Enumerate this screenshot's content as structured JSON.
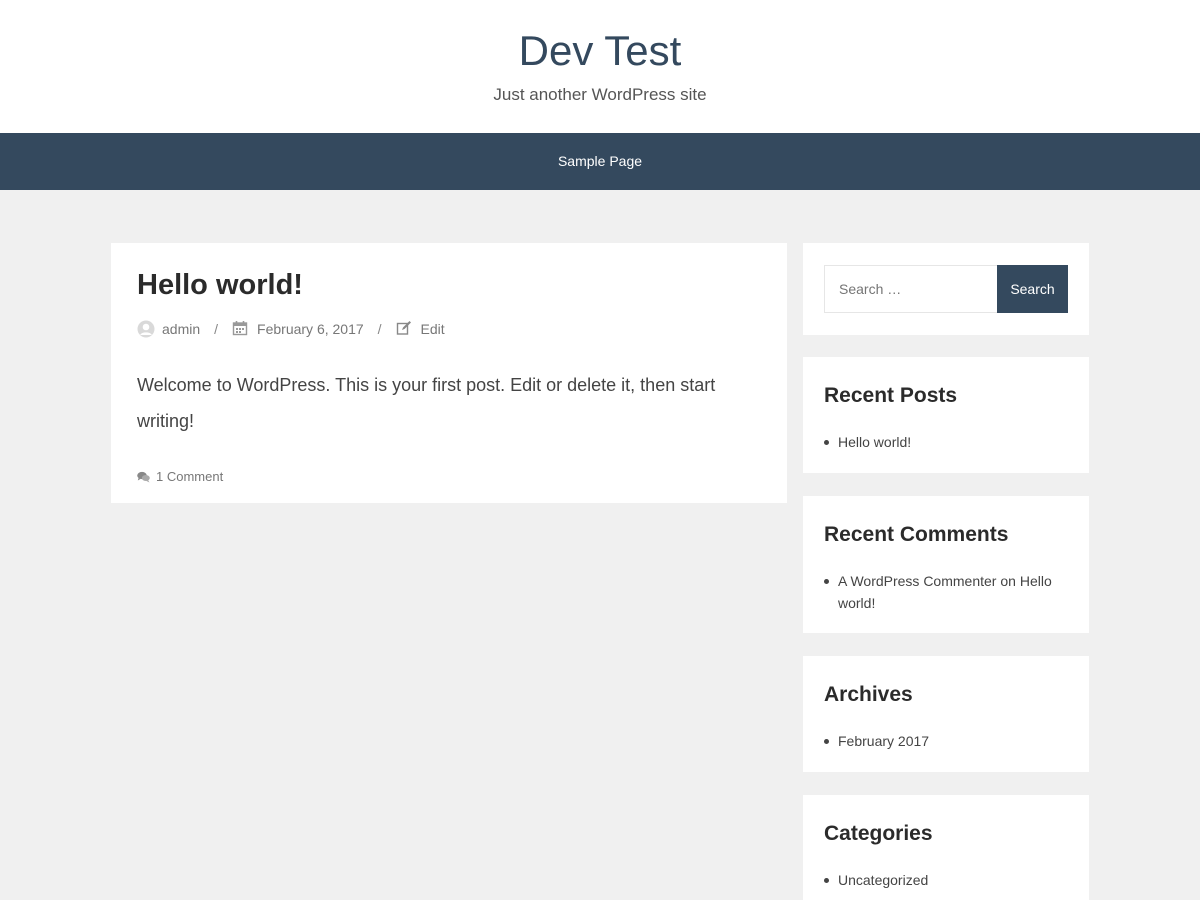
{
  "site": {
    "title": "Dev Test",
    "description": "Just another WordPress site"
  },
  "nav": {
    "items": [
      {
        "label": "Sample Page"
      }
    ]
  },
  "post": {
    "title": "Hello world!",
    "author": "admin",
    "date": "February 6, 2017",
    "edit_label": "Edit",
    "separator": "/",
    "content": "Welcome to WordPress. This is your first post. Edit or delete it, then start writing!",
    "comments_label": "1 Comment"
  },
  "sidebar": {
    "search": {
      "placeholder": "Search …",
      "button_label": "Search"
    },
    "recent_posts": {
      "title": "Recent Posts",
      "items": [
        {
          "label": "Hello world!"
        }
      ]
    },
    "recent_comments": {
      "title": "Recent Comments",
      "items": [
        {
          "author": "A WordPress Commenter",
          "on": "on",
          "post": "Hello world!"
        }
      ]
    },
    "archives": {
      "title": "Archives",
      "items": [
        {
          "label": "February 2017"
        }
      ]
    },
    "categories": {
      "title": "Categories",
      "items": [
        {
          "label": "Uncategorized"
        }
      ]
    }
  },
  "colors": {
    "header_bg": "#ffffff",
    "nav_bg": "#34495e",
    "page_bg": "#f0f0f0",
    "accent": "#34495e"
  },
  "icons": {
    "author": "user-avatar-icon",
    "date": "calendar-icon",
    "edit": "edit-icon",
    "comments": "comments-icon"
  }
}
